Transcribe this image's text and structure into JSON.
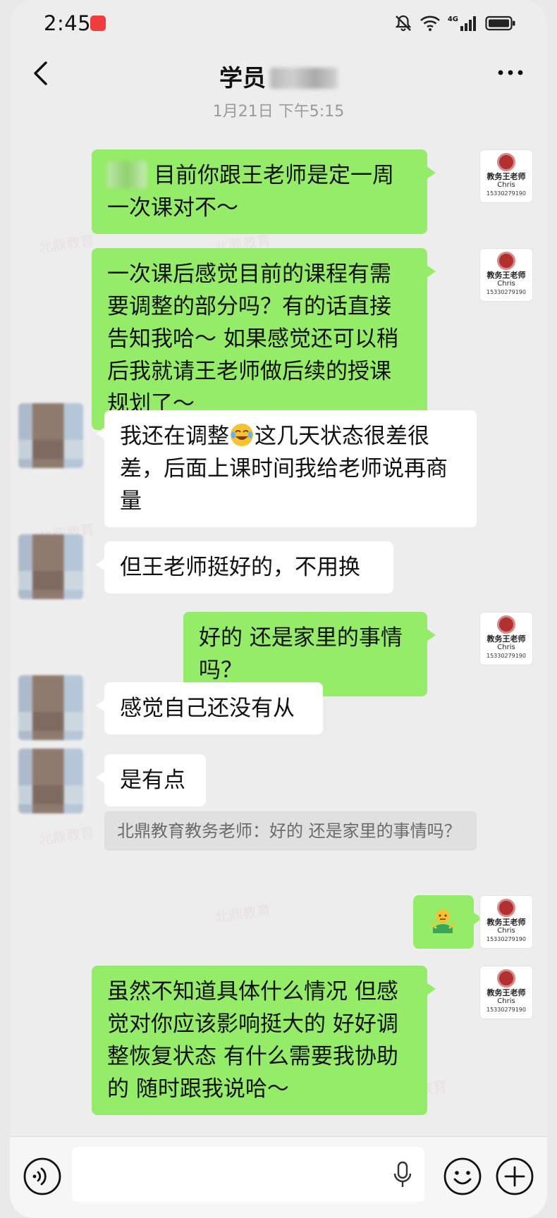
{
  "status_bar": {
    "time": "2:45",
    "network": "4G"
  },
  "header": {
    "title": "学员"
  },
  "timestamp": "1月21日 下午5:15",
  "teacher_avatar": {
    "name": "教务王老师",
    "sub": "Chris",
    "phone": "15330279190"
  },
  "watermark": {
    "text": "北鼎教育"
  },
  "messages": [
    {
      "sender": "teacher",
      "text": "目前你跟王老师是定一周一次课对不～"
    },
    {
      "sender": "teacher",
      "text": "一次课后感觉目前的课程有需要调整的部分吗？有的话直接告知我哈～ 如果感觉还可以稍后我就请王老师做后续的授课规划了～"
    },
    {
      "sender": "student",
      "text_before": "我还在调整",
      "text_after": "这几天状态很差很差，后面上课时间我给老师说再商量"
    },
    {
      "sender": "student",
      "text": "但王老师挺好的，不用换"
    },
    {
      "sender": "teacher",
      "text": "好的  还是家里的事情吗？"
    },
    {
      "sender": "student",
      "text": "感觉自己还没有从"
    },
    {
      "sender": "student",
      "text": "是有点"
    },
    {
      "sender": "teacher",
      "text": "虽然不知道具体什么情况  但感觉对你应该影响挺大的  好好调整恢复状态  有什么需要我协助的  随时跟我说哈～"
    }
  ],
  "quote": {
    "text": "北鼎教育教务老师：好的  还是家里的事情吗？"
  },
  "input": {
    "placeholder": ""
  },
  "colors": {
    "sent_bubble": "#95ec69",
    "received_bubble": "#ffffff",
    "background": "#ededed"
  }
}
